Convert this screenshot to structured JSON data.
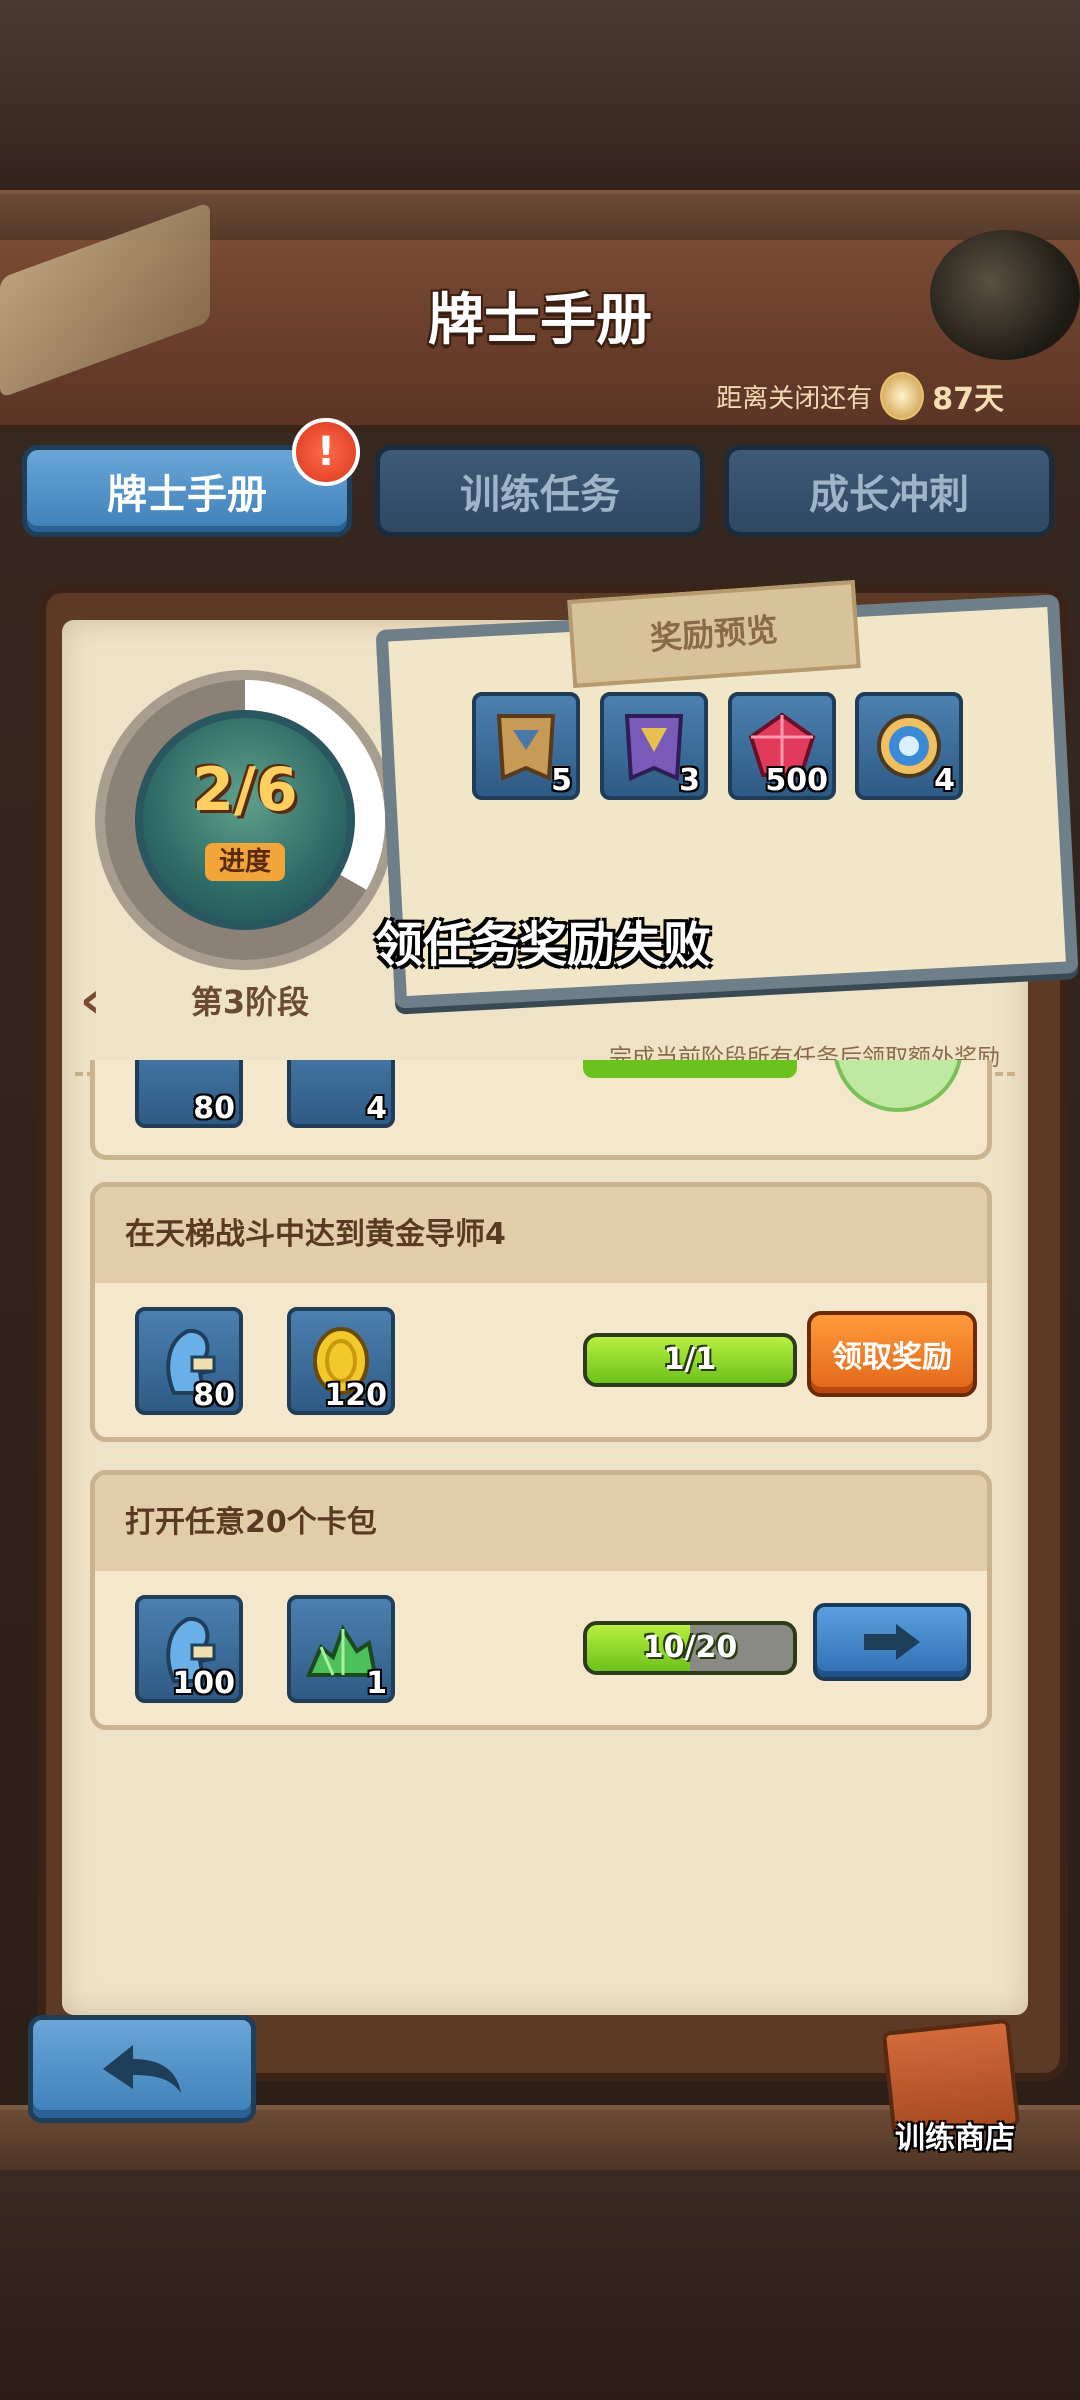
{
  "header": {
    "title": "牌士手册",
    "countdown_label": "距离关闭还有",
    "countdown_value": "87天"
  },
  "tabs": [
    {
      "label": "牌士手册",
      "active": true,
      "alert": "!"
    },
    {
      "label": "训练任务",
      "active": false
    },
    {
      "label": "成长冲刺",
      "active": false
    }
  ],
  "progress": {
    "value": "2/6",
    "label": "进度",
    "fraction": 0.333,
    "stage": "第3阶段"
  },
  "reward_preview": {
    "tag": "奖励预览",
    "items": [
      {
        "icon": "brown-card-pack-icon",
        "qty": "5"
      },
      {
        "icon": "purple-card-pack-icon",
        "qty": "3"
      },
      {
        "icon": "red-gem-icon",
        "qty": "500"
      },
      {
        "icon": "rainbow-orb-icon",
        "qty": "4"
      }
    ]
  },
  "toast": "领任务奖励失败",
  "bonus_note": "完成当前阶段所有任务后领取额外奖励",
  "partial_task": {
    "rewards": [
      {
        "icon": "trainer-xp-icon",
        "qty": "80"
      },
      {
        "icon": "gold-coin-icon",
        "qty": "4"
      }
    ]
  },
  "tasks": [
    {
      "title": "在天梯战斗中达到黄金导师4",
      "rewards": [
        {
          "icon": "trainer-xp-icon",
          "qty": "80"
        },
        {
          "icon": "gold-coin-icon",
          "qty": "120"
        }
      ],
      "progress_text": "1/1",
      "progress_fraction": 1.0,
      "action": "领取奖励"
    },
    {
      "title": "打开任意20个卡包",
      "rewards": [
        {
          "icon": "trainer-xp-icon",
          "qty": "100"
        },
        {
          "icon": "green-gem-pile-icon",
          "qty": "1"
        }
      ],
      "progress_text": "10/20",
      "progress_fraction": 0.5,
      "action": "go-arrow-icon"
    }
  ],
  "footer": {
    "shop_label": "训练商店"
  },
  "colors": {
    "tab_active": "#3d7fb8",
    "claim_orange": "#e2661a",
    "progress_green": "#6cc21c",
    "paper": "#efe3c7"
  }
}
